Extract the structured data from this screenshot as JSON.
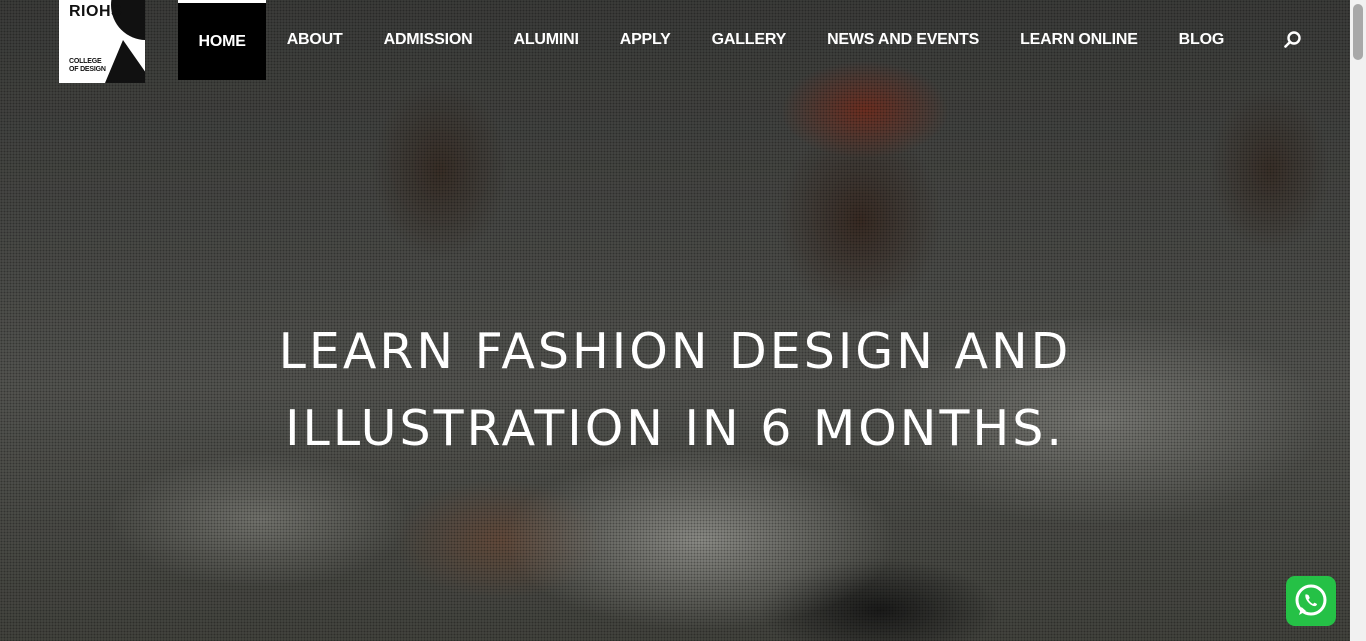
{
  "brand": {
    "name": "RIOHS",
    "subtitle_line1": "COLLEGE",
    "subtitle_line2": "OF DESIGN"
  },
  "nav": {
    "items": [
      {
        "label": "HOME",
        "active": true
      },
      {
        "label": "ABOUT"
      },
      {
        "label": "ADMISSION"
      },
      {
        "label": "ALUMINI"
      },
      {
        "label": "APPLY"
      },
      {
        "label": "GALLERY"
      },
      {
        "label": "NEWS AND EVENTS"
      },
      {
        "label": "LEARN ONLINE"
      },
      {
        "label": "BLOG"
      }
    ],
    "search_icon": "search-icon"
  },
  "hero": {
    "headline_line1": "LEARN FASHION DESIGN AND",
    "headline_line2": "ILLUSTRATION IN 6 MONTHS."
  },
  "chat_widget": {
    "icon": "whatsapp-icon",
    "color": "#25c146"
  },
  "colors": {
    "nav_active_bg": "#000000",
    "nav_text": "#ffffff",
    "logo_bg": "#ffffff"
  }
}
